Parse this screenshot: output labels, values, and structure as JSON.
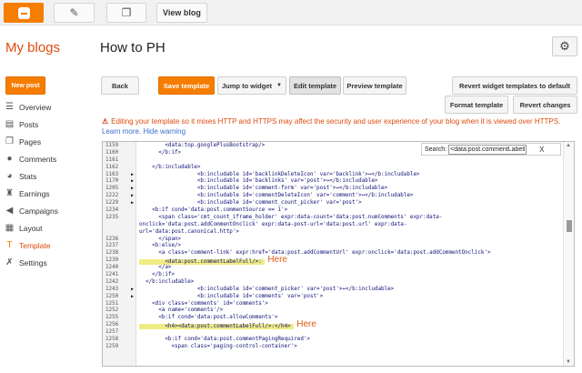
{
  "topbar": {
    "view_blog": "View blog"
  },
  "header": {
    "my_blogs": "My blogs",
    "blog_title": "How to PH"
  },
  "sidebar": {
    "new_post": "New post",
    "items": [
      {
        "label": "Overview",
        "icon": "list-icon"
      },
      {
        "label": "Posts",
        "icon": "posts-icon"
      },
      {
        "label": "Pages",
        "icon": "pages-icon"
      },
      {
        "label": "Comments",
        "icon": "comment-icon"
      },
      {
        "label": "Stats",
        "icon": "pie-chart-icon"
      },
      {
        "label": "Earnings",
        "icon": "trophy-icon"
      },
      {
        "label": "Campaigns",
        "icon": "megaphone-icon"
      },
      {
        "label": "Layout",
        "icon": "layout-icon"
      },
      {
        "label": "Template",
        "icon": "template-icon",
        "active": true
      },
      {
        "label": "Settings",
        "icon": "wrench-icon"
      }
    ]
  },
  "toolbar": {
    "back": "Back",
    "save_template": "Save template",
    "jump_to_widget": "Jump to widget",
    "edit_template": "Edit template",
    "preview_template": "Preview template",
    "revert_widgets": "Revert widget templates to default",
    "format_template": "Format template",
    "revert_changes": "Revert changes"
  },
  "warning": {
    "text": "Editing your template so it mixes HTTP and HTTPS may affect the security and user experience of your blog when it is viewed over HTTPS.",
    "link": "Learn more.",
    "hide": "Hide warning"
  },
  "search": {
    "label": "Search:",
    "value": "<data:post.commentLabelFul",
    "close": "X"
  },
  "annotations": [
    "Here",
    "Here"
  ],
  "colors": {
    "accent": "#f57d00",
    "sidebar_active": "#dd4b0e",
    "highlight": "#f0ec85"
  },
  "code_lines": [
    {
      "n": "1159",
      "t": "        <data:top.googlePlusBootstrap/>"
    },
    {
      "n": "1160",
      "t": "      </b:if>"
    },
    {
      "n": "1161",
      "t": ""
    },
    {
      "n": "1162",
      "t": "    </b:includable>"
    },
    {
      "n": "1163",
      "f": true,
      "t": "                  <b:includable id='backlinkDeleteIcon' var='backlink'>↔</b:includable>"
    },
    {
      "n": "1170",
      "f": true,
      "t": "                  <b:includable id='backlinks' var='post'>↔</b:includable>"
    },
    {
      "n": "1205",
      "f": true,
      "t": "                  <b:includable id='comment-form' var='post'>↔</b:includable>"
    },
    {
      "n": "1222",
      "f": true,
      "t": "                  <b:includable id='commentDeleteIcon' var='comment'>↔</b:includable>"
    },
    {
      "n": "1229",
      "f": true,
      "t": "                  <b:includable id='comment_count_picker' var='post'>"
    },
    {
      "n": "1234",
      "t": "    <b:if cond='data:post.commentSource == 1'>"
    },
    {
      "n": "1235",
      "t": "      <span class='cmt_count_iframe_holder' expr:data-count='data:post.numComments' expr:data-"
    },
    {
      "n": "",
      "t": "onclick='data:post.addCommentOnclick' expr:data-post-url='data:post.url' expr:data-"
    },
    {
      "n": "",
      "t": "url='data:post.canonical.http'>"
    },
    {
      "n": "1236",
      "t": "      </span>"
    },
    {
      "n": "1237",
      "t": "    <b:else/>"
    },
    {
      "n": "1238",
      "t": "      <a class='comment-link' expr:href='data:post.addCommentUrl' expr:onclick='data:post.addCommentOnclick'>"
    },
    {
      "n": "1239",
      "hl": true,
      "t": "        <data:post.commentLabelFull/>: ",
      "ann": 0
    },
    {
      "n": "1240",
      "t": "      </a>"
    },
    {
      "n": "1241",
      "t": "    </b:if>"
    },
    {
      "n": "1242",
      "t": "  </b:includable>"
    },
    {
      "n": "1243",
      "f": true,
      "t": "                  <b:includable id='comment_picker' var='post'>↔</b:includable>"
    },
    {
      "n": "1250",
      "f": true,
      "t": "                  <b:includable id='comments' var='post'>"
    },
    {
      "n": "1251",
      "t": "    <div class='comments' id='comments'>"
    },
    {
      "n": "1252",
      "t": "      <a name='comments'/>"
    },
    {
      "n": "1255",
      "t": "      <b:if cond='data:post.allowComments'>"
    },
    {
      "n": "1256",
      "hl": true,
      "t": "        <h4><data:post.commentLabelFull/>:</h4> ",
      "ann": 1
    },
    {
      "n": "1257",
      "t": ""
    },
    {
      "n": "1258",
      "t": "        <b:if cond='data:post.commentPagingRequired'>"
    },
    {
      "n": "1259",
      "t": "          <span class='paging-control-container'>"
    }
  ]
}
